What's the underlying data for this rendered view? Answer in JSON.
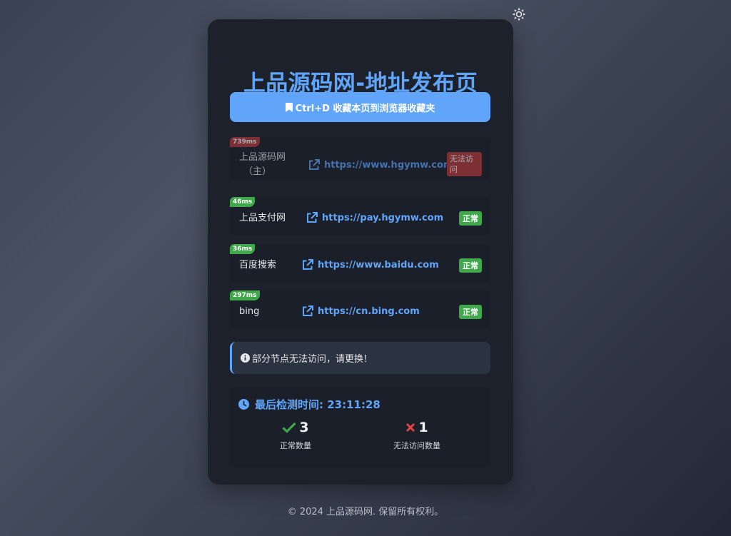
{
  "header": {
    "title": "上品源码网-地址发布页",
    "theme_toggle_icon": "sun-icon"
  },
  "bookmark": {
    "label": "Ctrl+D 收藏本页到浏览器收藏夹",
    "icon": "bookmark-icon"
  },
  "sites": [
    {
      "latency": "739ms",
      "name_line1": "上品源码网",
      "name_line2": "（主）",
      "url": "https://www.hgymw.com",
      "status": "无法访问",
      "ok": false
    },
    {
      "latency": "46ms",
      "name_line1": "上品支付网",
      "url": "https://pay.hgymw.com",
      "status": "正常",
      "ok": true
    },
    {
      "latency": "36ms",
      "name_line1": "百度搜索",
      "url": "https://www.baidu.com",
      "status": "正常",
      "ok": true
    },
    {
      "latency": "297ms",
      "name_line1": "bing",
      "url": "https://cn.bing.com",
      "status": "正常",
      "ok": true
    }
  ],
  "notice": {
    "icon": "info-icon",
    "text": "部分节点无法访问，请更换！"
  },
  "stats": {
    "last_check_label": "最后检测时间: 23:11:28",
    "ok_count": "3",
    "ok_label": "正常数量",
    "fail_count": "1",
    "fail_label": "无法访问数量"
  },
  "colors": {
    "accent": "#60a5fa",
    "ok": "#3fa84a",
    "fail": "#e04444",
    "card": "#1c212c"
  },
  "footer": {
    "text": "© 2024 上品源码网. 保留所有权利。"
  }
}
